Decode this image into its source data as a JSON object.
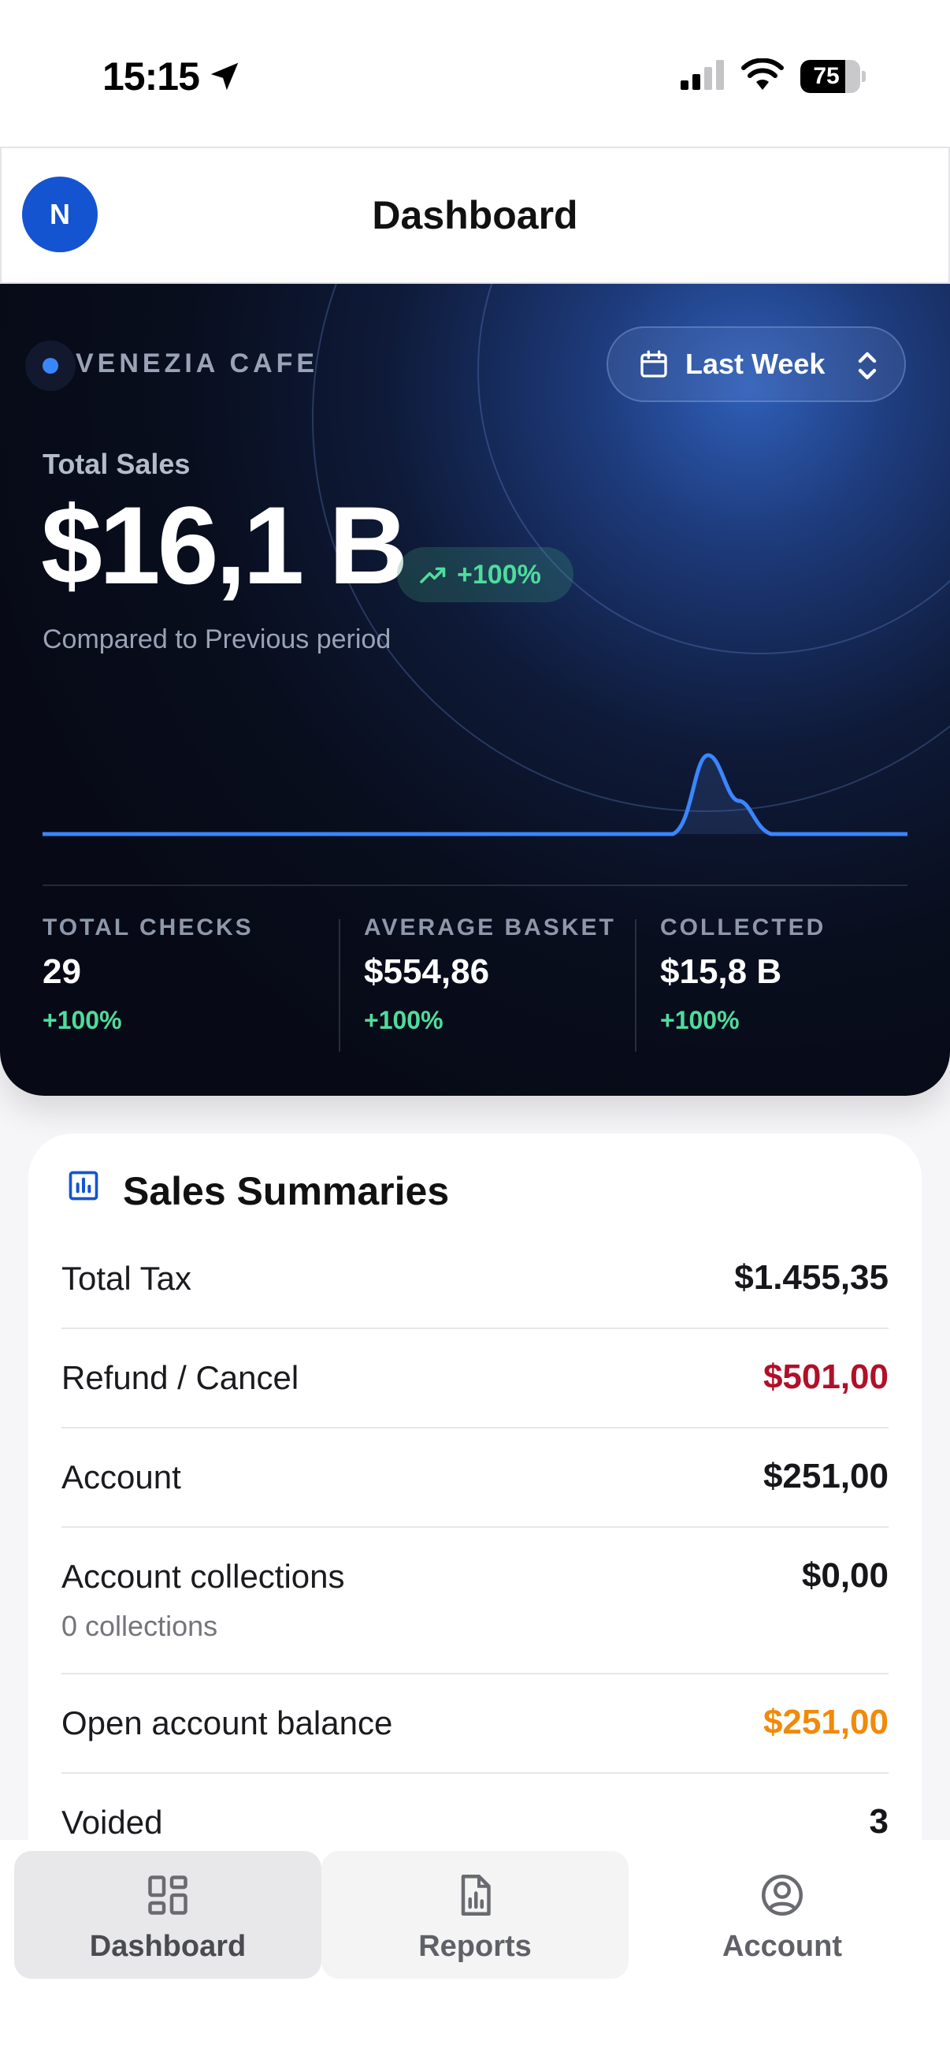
{
  "status_bar": {
    "time": "15:15",
    "battery": "75",
    "battery_level": 0.75
  },
  "header": {
    "avatar_initial": "N",
    "title": "Dashboard"
  },
  "hero": {
    "cafe_name": "VENEZIA CAFE",
    "period": "Last Week",
    "total_sales_label": "Total Sales",
    "total_sales_value": "$16,1 B",
    "trend": "+100%",
    "compared": "Compared to Previous period",
    "stats": [
      {
        "label": "TOTAL CHECKS",
        "value": "29",
        "change": "+100%"
      },
      {
        "label": "AVERAGE BASKET",
        "value": "$554,86",
        "change": "+100%"
      },
      {
        "label": "COLLECTED",
        "value": "$15,8 B",
        "change": "+100%"
      }
    ]
  },
  "chart_data": {
    "type": "line",
    "x": [
      0,
      1,
      2,
      3,
      4,
      5,
      6
    ],
    "y": [
      0,
      0,
      0,
      0,
      0,
      16.1,
      0
    ],
    "title": "",
    "xlabel": "",
    "ylabel": "",
    "grid": false
  },
  "summaries": {
    "title": "Sales Summaries",
    "rows": [
      {
        "label": "Total Tax",
        "value": "$1.455,35",
        "color": "#17171b"
      },
      {
        "label": "Refund / Cancel",
        "value": "$501,00",
        "color": "#b0102a"
      },
      {
        "label": "Account",
        "value": "$251,00",
        "color": "#17171b"
      },
      {
        "label": "Account collections",
        "sub": "0 collections",
        "value": "$0,00",
        "color": "#17171b"
      },
      {
        "label": "Open account balance",
        "value": "$251,00",
        "color": "#f08a0a"
      },
      {
        "label": "Voided",
        "value": "3",
        "color": "#17171b"
      }
    ]
  },
  "tabs": [
    {
      "label": "Dashboard",
      "icon": "dashboard-icon",
      "active": true
    },
    {
      "label": "Reports",
      "icon": "reports-icon",
      "active": false
    },
    {
      "label": "Account",
      "icon": "account-icon",
      "active": false
    }
  ],
  "colors": {
    "accent": "#1454d0",
    "positive": "#4fdc9c",
    "negative": "#b0102a",
    "warning": "#f08a0a",
    "line": "#3a86ff"
  }
}
